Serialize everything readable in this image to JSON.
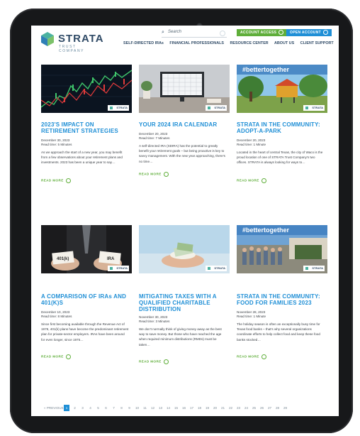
{
  "brand": {
    "name": "STRATA",
    "sub": "TRUST COMPANY"
  },
  "search": {
    "placeholder": "Search"
  },
  "header_buttons": {
    "account_access": "ACCOUNT ACCESS",
    "open_account": "OPEN ACCOUNT"
  },
  "nav": {
    "items": [
      "SELF-DIRECTED IRAs",
      "FINANCIAL PROFESSIONALS",
      "RESOURCE CENTER",
      "ABOUT US",
      "CLIENT SUPPORT"
    ]
  },
  "cards": [
    {
      "title": "2023'S IMPACT ON RETIREMENT STRATEGIES",
      "date": "December 30, 2023",
      "read": "Read time: 5 Minutes",
      "excerpt": "As we approach the start of a new year, you may benefit from a few observations about your retirement plans and investments. 2023 has been a unique year to say…",
      "more": "READ MORE",
      "tag": "STRATA"
    },
    {
      "title": "YOUR 2024 IRA CALENDAR",
      "date": "December 20, 2023",
      "read": "Read time: 7 Minutes",
      "excerpt": "A self-directed IRA (SDIRA) has the potential to greatly benefit your retirement goals – but being proactive is key to savvy management. With the new year approaching, there's no time…",
      "more": "READ MORE",
      "tag": "STRATA"
    },
    {
      "title": "STRATA IN THE COMMUNITY: ADOPT-A-PARK",
      "date": "December 20, 2023",
      "read": "Read time: 1 Minute",
      "excerpt": "Located in the heart of central Texas, the city of Waco is the proud location of one of STRATA Trust Company's two offices. STRATA is always looking for ways to…",
      "more": "READ MORE",
      "tag": "STRATA",
      "overlay": "#bettertogether"
    },
    {
      "title": "A COMPARISON OF IRAs AND 401(K)S",
      "date": "December 10, 2023",
      "read": "Read time: 8 Minutes",
      "excerpt": "Since first becoming available through the Revenue Act of 1978, 401(k) plans have become the predominant retirement plan for private-sector employers. IRAs have been around for even longer, since 1975…",
      "more": "READ MORE",
      "tag": "STRATA",
      "labels": [
        "401(k)",
        "IRA"
      ]
    },
    {
      "title": "MITIGATING TAXES WITH A QUALIFIED CHARITABLE DISTRIBUTION",
      "date": "November 30, 2023",
      "read": "Read time: 3 Minutes",
      "excerpt": "We don't normally think of giving money away as the best way to save money. But those who have reached the age when required minimum distributions (RMDs) must be taken…",
      "more": "READ MORE",
      "tag": "STRATA"
    },
    {
      "title": "STRATA IN THE COMMUNITY: FOOD FOR FAMILIES 2023",
      "date": "November 28, 2023",
      "read": "Read time: 1 Minute",
      "excerpt": "The holiday season is often an exceptionally busy time for Texas food banks – that's why several organizations coordinate efforts to help collect food and keep these food banks stocked…",
      "more": "READ MORE",
      "tag": "STRATA",
      "overlay": "#bettertogether"
    }
  ],
  "pager": {
    "prev": "« PREVIOUS",
    "pages": [
      "1",
      "2",
      "3",
      "4",
      "5",
      "6",
      "7",
      "8",
      "9",
      "10",
      "11",
      "12",
      "13",
      "14",
      "15",
      "16",
      "17",
      "18",
      "19",
      "20",
      "21",
      "22",
      "23",
      "24",
      "25",
      "26",
      "27",
      "28",
      "29"
    ],
    "current": "1"
  },
  "colors": {
    "accent_blue": "#1f8fd6",
    "accent_green": "#5fae3a",
    "navy": "#2f4a66"
  }
}
